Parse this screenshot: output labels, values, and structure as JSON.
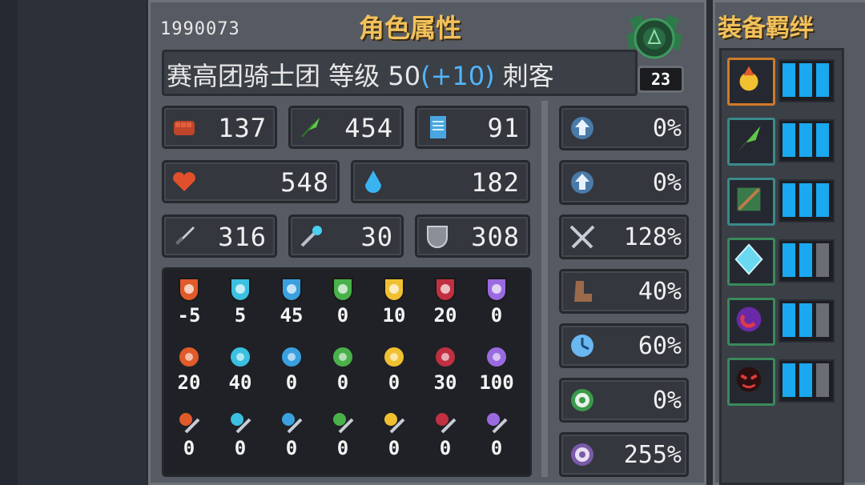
{
  "player_id": "1990073",
  "title": "角色属性",
  "header": {
    "guild": "赛高团骑士团",
    "level_label": "等级",
    "level": "50",
    "level_bonus": "(+10)",
    "class_name": "刺客",
    "badge": "23"
  },
  "stats": {
    "strength": "137",
    "agility": "454",
    "intellect": "91",
    "hp": "548",
    "mana": "182",
    "attack": "316",
    "magic_attack": "30",
    "armor": "308"
  },
  "resistances": {
    "row1": [
      "-5",
      "5",
      "45",
      "0",
      "10",
      "20",
      "0"
    ],
    "row2": [
      "20",
      "40",
      "0",
      "0",
      "0",
      "30",
      "100"
    ],
    "row3": [
      "0",
      "0",
      "0",
      "0",
      "0",
      "0",
      "0"
    ]
  },
  "percent_stats": [
    "0%",
    "0%",
    "128%",
    "40%",
    "60%",
    "0%",
    "255%"
  ],
  "side": {
    "title": "装备羁绊",
    "bonds": [
      {
        "icon": "fire-orb-icon",
        "level": 3,
        "max": 3,
        "border": "#d07a2a"
      },
      {
        "icon": "leaf-icon",
        "level": 3,
        "max": 3,
        "border": "#3a8a8a"
      },
      {
        "icon": "ranger-icon",
        "level": 3,
        "max": 3,
        "border": "#3a8a8a"
      },
      {
        "icon": "ice-crystal-icon",
        "level": 2,
        "max": 3,
        "border": "#3a8a5a"
      },
      {
        "icon": "void-orb-icon",
        "level": 2,
        "max": 3,
        "border": "#3a8a5a"
      },
      {
        "icon": "demon-face-icon",
        "level": 2,
        "max": 3,
        "border": "#3a8a5a"
      }
    ]
  },
  "colors": {
    "title": "#f2c15a",
    "bonus": "#4fb6ff",
    "bar_fill": "#1aa8f0"
  }
}
